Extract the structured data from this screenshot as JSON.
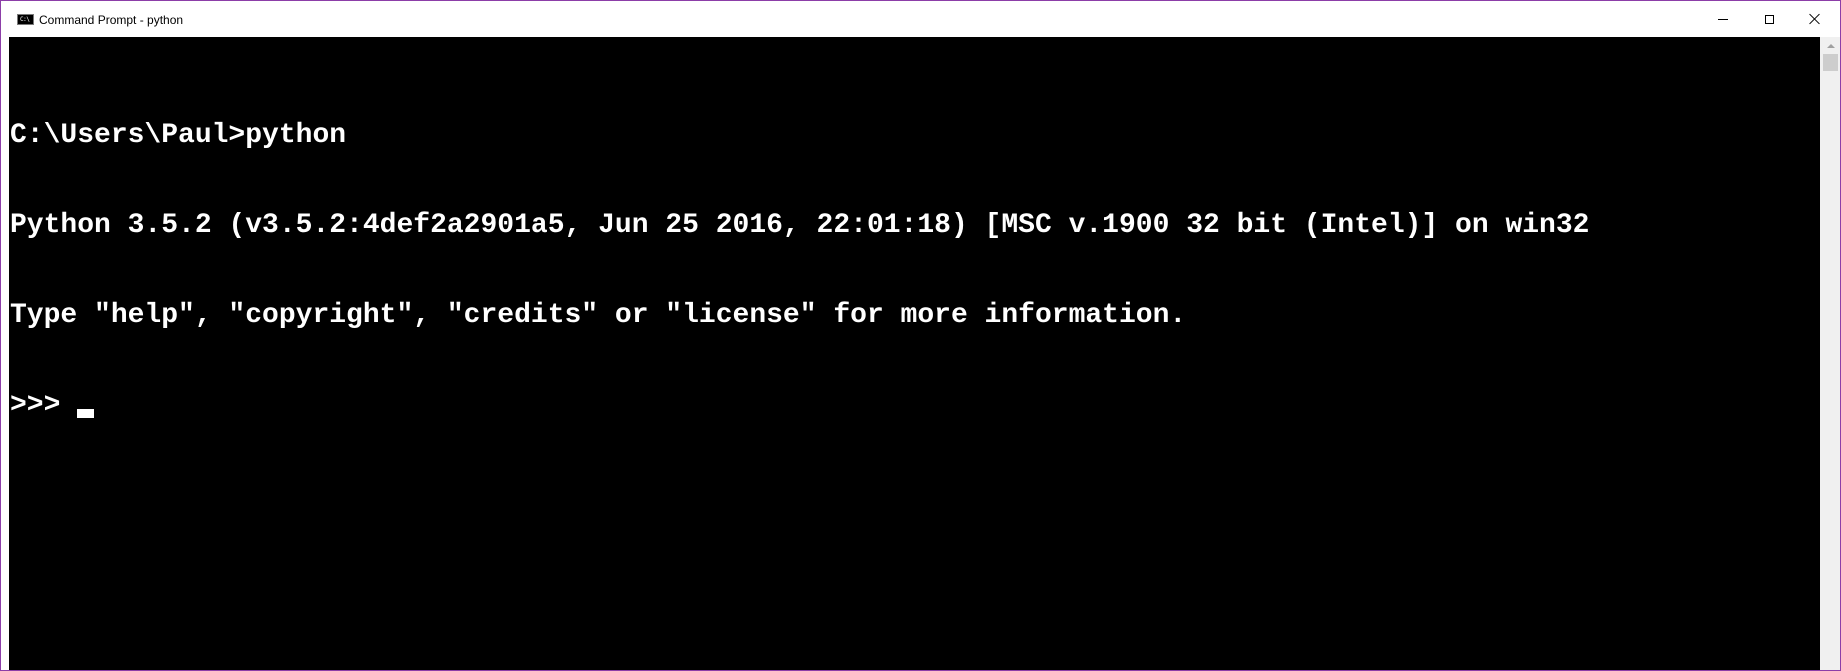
{
  "window": {
    "title": "Command Prompt - python",
    "icon": "command-prompt-icon",
    "icon_text": "C:\\",
    "controls": {
      "minimize": "minimize-icon",
      "maximize": "maximize-icon",
      "close": "close-icon"
    }
  },
  "console": {
    "background": "#000000",
    "foreground": "#ffffff",
    "lines": [
      "C:\\Users\\Paul>python",
      "Python 3.5.2 (v3.5.2:4def2a2901a5, Jun 25 2016, 22:01:18) [MSC v.1900 32 bit (Intel)] on win32",
      "Type \"help\", \"copyright\", \"credits\" or \"license\" for more information."
    ],
    "prompt": ">>> "
  },
  "accent_border": "#8c3ea8"
}
